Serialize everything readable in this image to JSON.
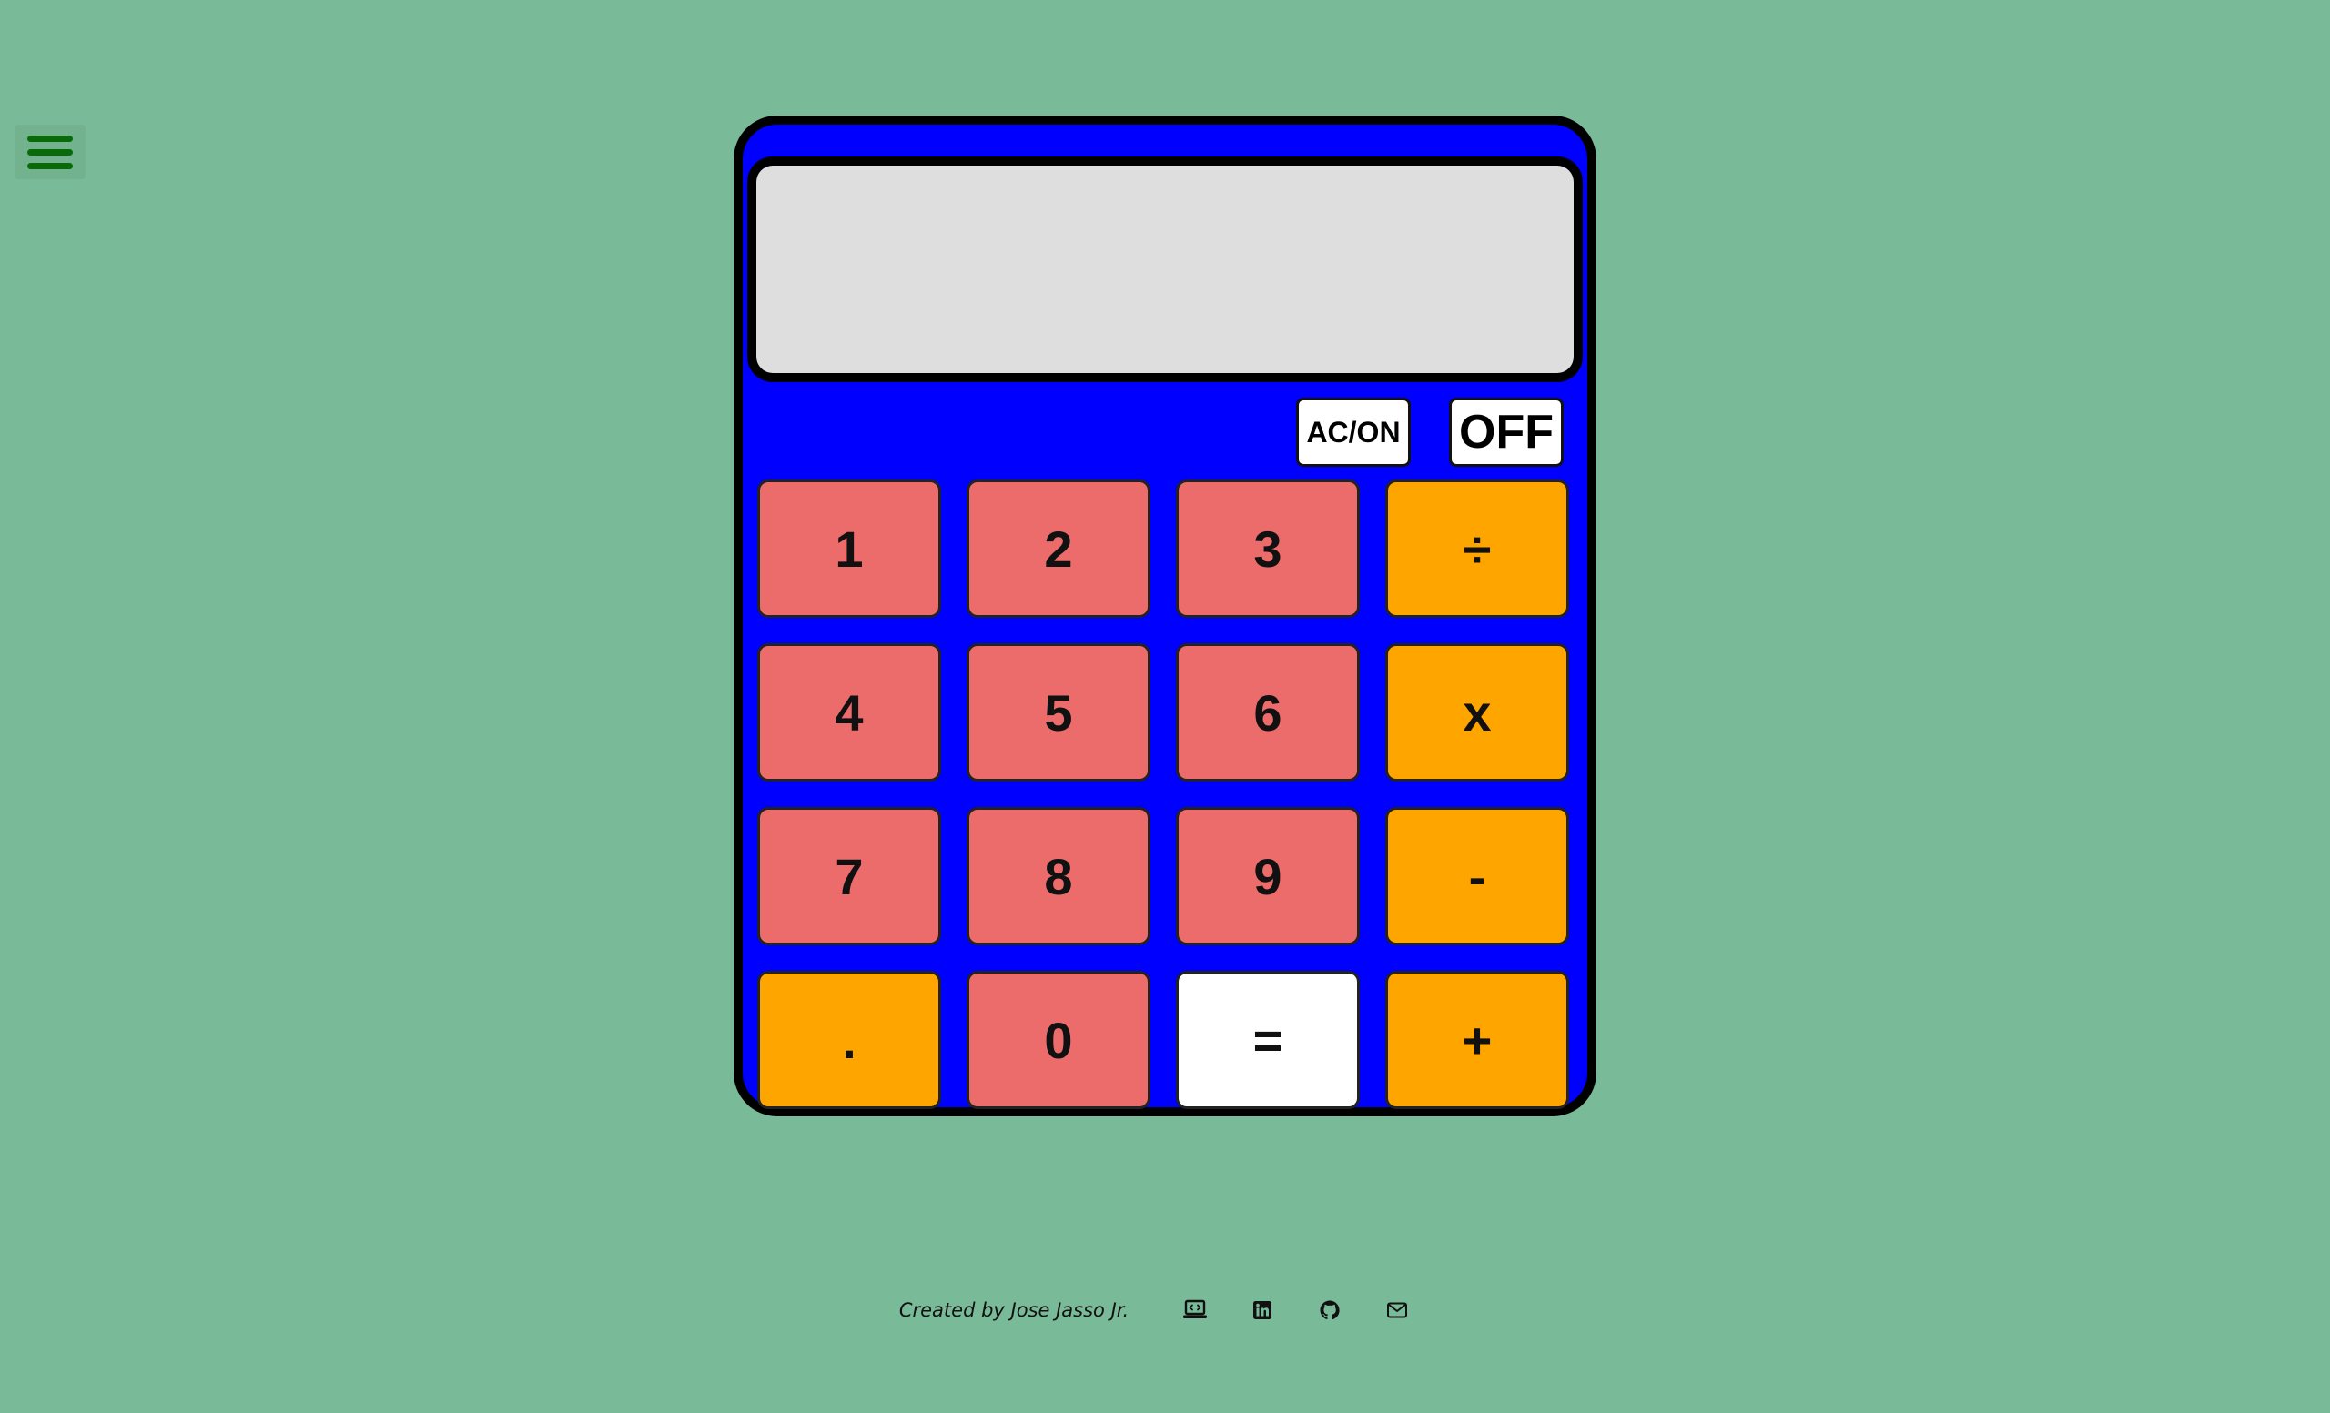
{
  "menu": {
    "icon": "hamburger-menu-icon",
    "color": "#0a6a0a"
  },
  "calculator": {
    "display_value": "",
    "controls": {
      "clear_on_label": "AC/ON",
      "off_label": "OFF"
    },
    "keys": [
      {
        "label": "1",
        "type": "number",
        "name": "key-1"
      },
      {
        "label": "2",
        "type": "number",
        "name": "key-2"
      },
      {
        "label": "3",
        "type": "number",
        "name": "key-3"
      },
      {
        "label": "÷",
        "type": "operator",
        "name": "key-divide"
      },
      {
        "label": "4",
        "type": "number",
        "name": "key-4"
      },
      {
        "label": "5",
        "type": "number",
        "name": "key-5"
      },
      {
        "label": "6",
        "type": "number",
        "name": "key-6"
      },
      {
        "label": "x",
        "type": "operator",
        "name": "key-multiply"
      },
      {
        "label": "7",
        "type": "number",
        "name": "key-7"
      },
      {
        "label": "8",
        "type": "number",
        "name": "key-8"
      },
      {
        "label": "9",
        "type": "number",
        "name": "key-9"
      },
      {
        "label": "-",
        "type": "operator",
        "name": "key-subtract"
      },
      {
        "label": ".",
        "type": "operator",
        "name": "key-decimal"
      },
      {
        "label": "0",
        "type": "number",
        "name": "key-0"
      },
      {
        "label": "=",
        "type": "equals",
        "name": "key-equals"
      },
      {
        "label": "+",
        "type": "operator",
        "name": "key-add"
      }
    ]
  },
  "footer": {
    "credit": "Created by Jose Jasso Jr.",
    "links": [
      {
        "icon": "laptop-code-icon",
        "name": "portfolio-link"
      },
      {
        "icon": "linkedin-icon",
        "name": "linkedin-link"
      },
      {
        "icon": "github-icon",
        "name": "github-link"
      },
      {
        "icon": "envelope-icon",
        "name": "email-link"
      }
    ]
  },
  "colors": {
    "background": "#79bb99",
    "calculator_body": "#0000ff",
    "number_key": "#ec6b6b",
    "operator_key": "#ffa500",
    "equals_key": "#ffffff",
    "display": "#dedede"
  }
}
